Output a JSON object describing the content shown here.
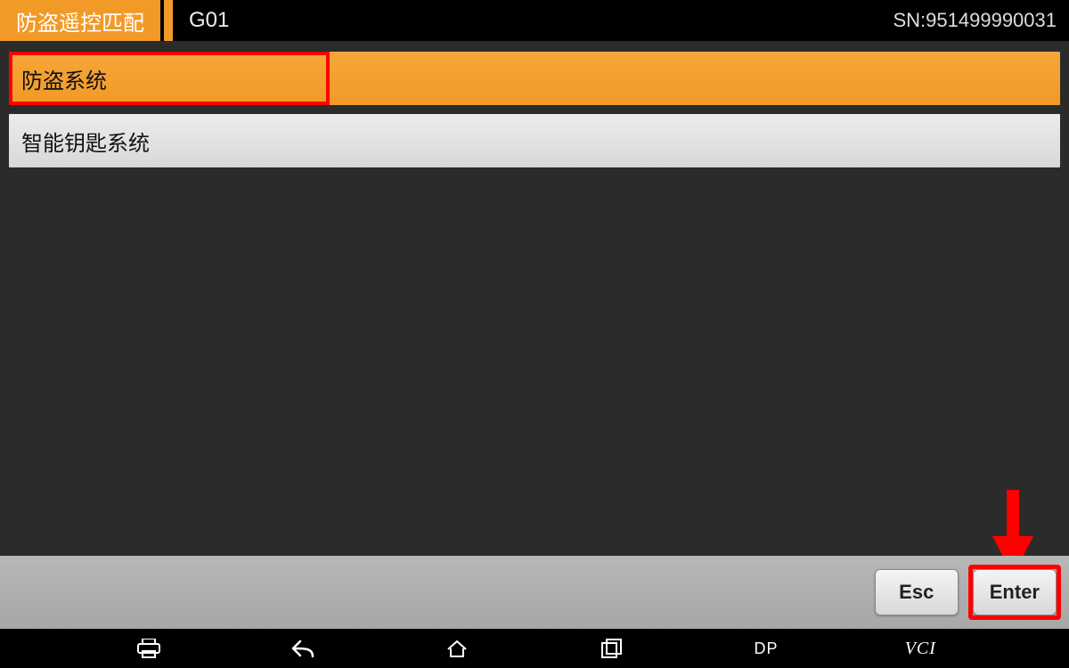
{
  "header": {
    "title": "防盗遥控匹配",
    "model": "G01",
    "serial_label": "SN:951499990031"
  },
  "menu": {
    "items": [
      {
        "label": "防盗系统",
        "selected": true
      },
      {
        "label": "智能钥匙系统",
        "selected": false
      }
    ]
  },
  "footer": {
    "esc_label": "Esc",
    "enter_label": "Enter"
  },
  "nav": {
    "dp_label": "DP",
    "vci_label": "VCI"
  }
}
